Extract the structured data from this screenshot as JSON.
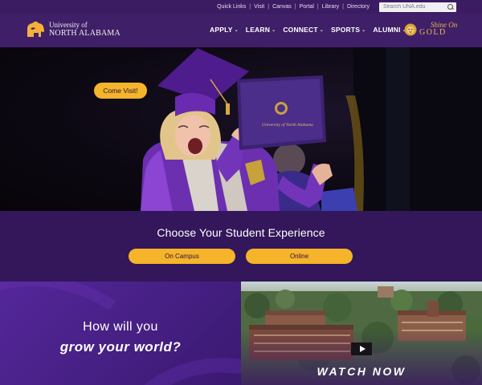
{
  "utility": {
    "links": [
      "Quick Links",
      "Visit",
      "Canvas",
      "Portal",
      "Library",
      "Directory"
    ],
    "search_placeholder": "Search UNA.edu"
  },
  "brand": {
    "line1": "University of",
    "line2": "NORTH ALABAMA"
  },
  "nav": {
    "items": [
      "APPLY",
      "LEARN",
      "CONNECT",
      "SPORTS",
      "ALUMNI"
    ]
  },
  "shine": {
    "line1": "Shine On",
    "line2": "GOLD"
  },
  "hero": {
    "diploma_text": "University of North Alabama"
  },
  "choose": {
    "heading": "Choose Your Student Experience",
    "buttons": [
      "On Campus",
      "Online"
    ]
  },
  "grow": {
    "line1": "How will you",
    "line2": "grow your world?",
    "cta": "Come Visit!"
  },
  "video": {
    "cta": "WATCH NOW"
  },
  "colors": {
    "purple_dark": "#33175a",
    "purple_nav": "#3f1f68",
    "gold": "#f5b42a",
    "gold_logo": "#e9b94a"
  }
}
